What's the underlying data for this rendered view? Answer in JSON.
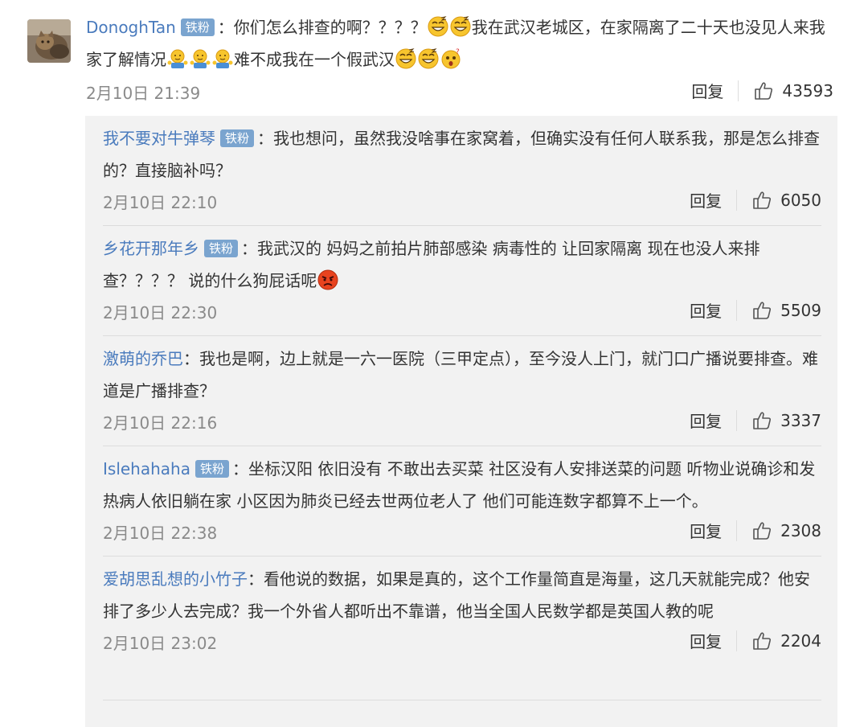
{
  "main_comment": {
    "username": "DonoghTan",
    "badge": "铁粉",
    "text_part1": "：你们怎么排查的啊？？？？",
    "text_part2": "我在武汉老城区，在家隔离了二十天也没见人来我家了解情况",
    "text_part3": "难不成我在一个假武汉",
    "timestamp": "2月10日 21:39",
    "reply_label": "回复",
    "likes": "43593"
  },
  "replies": [
    {
      "username": "我不要对牛弹琴",
      "badge": "铁粉",
      "text": "：我也想问，虽然我没啥事在家窝着，但确实没有任何人联系我，那是怎么排查的？直接脑补吗？",
      "timestamp": "2月10日 22:10",
      "reply_label": "回复",
      "likes": "6050"
    },
    {
      "username": "乡花开那年乡",
      "badge": "铁粉",
      "text": "：我武汉的 妈妈之前拍片肺部感染 病毒性的 让回家隔离 现在也没人来排查？？？？ 说的什么狗屁话呢",
      "timestamp": "2月10日 22:30",
      "reply_label": "回复",
      "likes": "5509"
    },
    {
      "username": "激萌的乔巴",
      "badge": "",
      "text": "：我也是啊，边上就是一六一医院（三甲定点），至今没人上门，就门口广播说要排查。难道是广播排查？",
      "timestamp": "2月10日 22:16",
      "reply_label": "回复",
      "likes": "3337"
    },
    {
      "username": "Islehahaha",
      "badge": "铁粉",
      "text": "：坐标汉阳 依旧没有 不敢出去买菜 社区没有人安排送菜的问题 听物业说确诊和发热病人依旧躺在家 小区因为肺炎已经去世两位老人了 他们可能连数字都算不上一个。",
      "timestamp": "2月10日 22:38",
      "reply_label": "回复",
      "likes": "2308"
    },
    {
      "username": "爱胡思乱想的小竹子",
      "badge": "",
      "text": "：看他说的数据，如果是真的，这个工作量简直是海量，这几天就能完成？他安排了多少人去完成？我一个外省人都听出不靠谱，他当全国人民数学都是英国人教的呢",
      "timestamp": "2月10日 23:02",
      "reply_label": "回复",
      "likes": "2204"
    }
  ]
}
